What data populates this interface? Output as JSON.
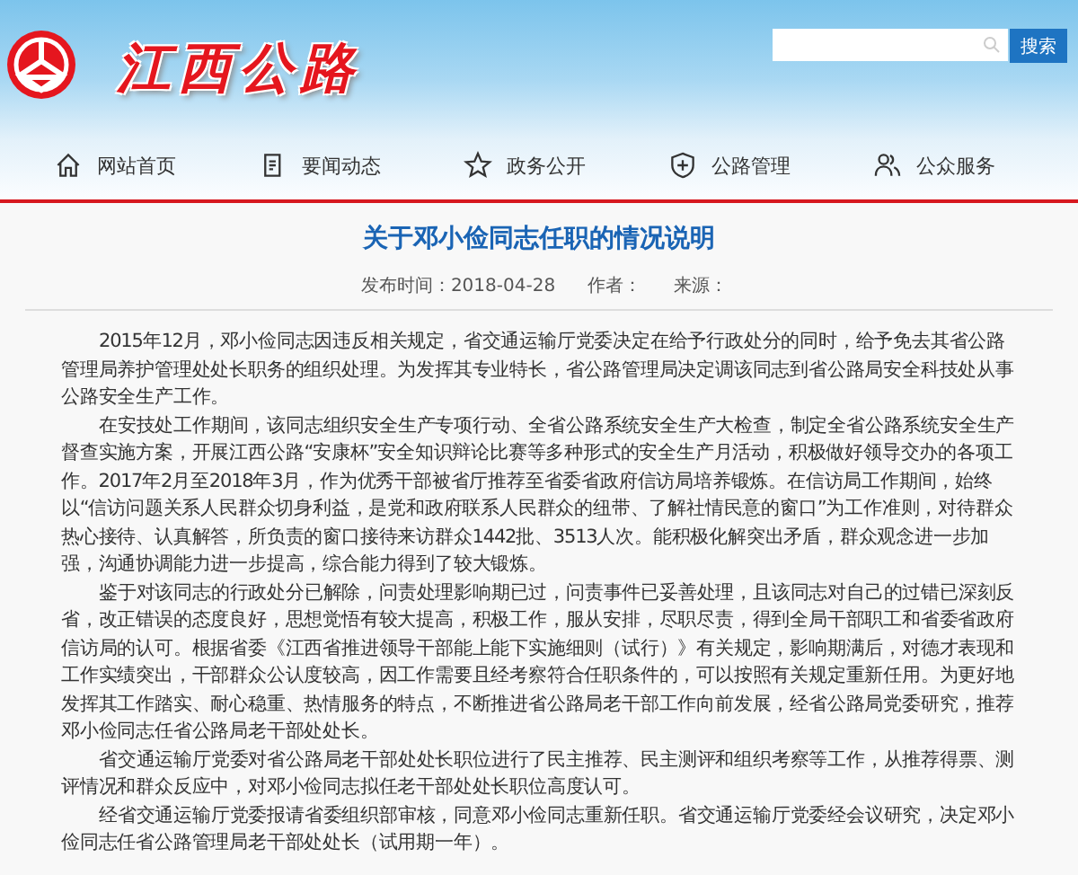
{
  "header": {
    "logo_text": "江西公路",
    "search": {
      "button": "搜索"
    }
  },
  "nav": [
    {
      "label": "网站首页"
    },
    {
      "label": "要闻动态"
    },
    {
      "label": "政务公开"
    },
    {
      "label": "公路管理"
    },
    {
      "label": "公众服务"
    }
  ],
  "article": {
    "title": "关于邓小俭同志任职的情况说明",
    "meta": [
      {
        "label": "发布时间：2018-04-28"
      },
      {
        "label": "作者："
      },
      {
        "label": "来源："
      }
    ],
    "paragraphs": [
      "2015年12月，邓小俭同志因违反相关规定，省交通运输厅党委决定在给予行政处分的同时，给予免去其省公路管理局养护管理处处长职务的组织处理。为发挥其专业特长，省公路管理局决定调该同志到省公路局安全科技处从事公路安全生产工作。",
      "在安技处工作期间，该同志组织安全生产专项行动、全省公路系统安全生产大检查，制定全省公路系统安全生产督查实施方案，开展江西公路“安康杯”安全知识辩论比赛等多种形式的安全生产月活动，积极做好领导交办的各项工作。2017年2月至2018年3月，作为优秀干部被省厅推荐至省委省政府信访局培养锻炼。在信访局工作期间，始终以“信访问题关系人民群众切身利益，是党和政府联系人民群众的纽带、了解社情民意的窗口”为工作准则，对待群众热心接待、认真解答，所负责的窗口接待来访群众1442批、3513人次。能积极化解突出矛盾，群众观念进一步加强，沟通协调能力进一步提高，综合能力得到了较大锻炼。",
      "鉴于对该同志的行政处分已解除，问责处理影响期已过，问责事件已妥善处理，且该同志对自己的过错已深刻反省，改正错误的态度良好，思想觉悟有较大提高，积极工作，服从安排，尽职尽责，得到全局干部职工和省委省政府信访局的认可。根据省委《江西省推进领导干部能上能下实施细则（试行）》有关规定，影响期满后，对德才表现和工作实绩突出，干部群众公认度较高，因工作需要且经考察符合任职条件的，可以按照有关规定重新任用。为更好地发挥其工作踏实、耐心稳重、热情服务的特点，不断推进省公路局老干部工作向前发展，经省公路局党委研究，推荐邓小俭同志任省公路局老干部处处长。",
      "省交通运输厅党委对省公路局老干部处处长职位进行了民主推荐、民主测评和组织考察等工作，从推荐得票、测评情况和群众反应中，对邓小俭同志拟任老干部处处长职位高度认可。",
      "经省交通运输厅党委报请省委组织部审核，同意邓小俭同志重新任职。省交通运输厅党委经会议研究，决定邓小俭同志任省公路管理局老干部处处长（试用期一年）。"
    ]
  }
}
